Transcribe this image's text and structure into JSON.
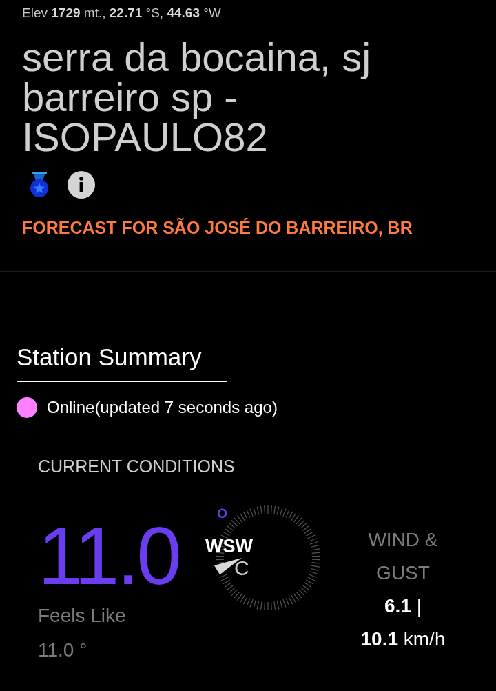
{
  "location_line": "Elev **1729** mt., **22.71** °S, **44.63** °W",
  "station_title": "serra da bocaina, sj barreiro sp - ISOPAULO82",
  "forecast_link": "FORECAST FOR SÃO JOSÉ DO BARREIRO, BR",
  "summary": {
    "heading": "Station Summary",
    "status": {
      "text": "Online(updated 7 seconds ago)",
      "color": "#ff80ff"
    }
  },
  "current_conditions": {
    "heading": "CURRENT CONDITIONS",
    "temperature": "11.0",
    "degree": "°",
    "unit": "C",
    "feels_like_label": "Feels Like",
    "feels_like": "11.0 °",
    "wind_direction": "WSW",
    "wind_label": "WIND & GUST",
    "wind_speed": "**6.1** |",
    "gust_speed": "**10.1** km/h"
  }
}
